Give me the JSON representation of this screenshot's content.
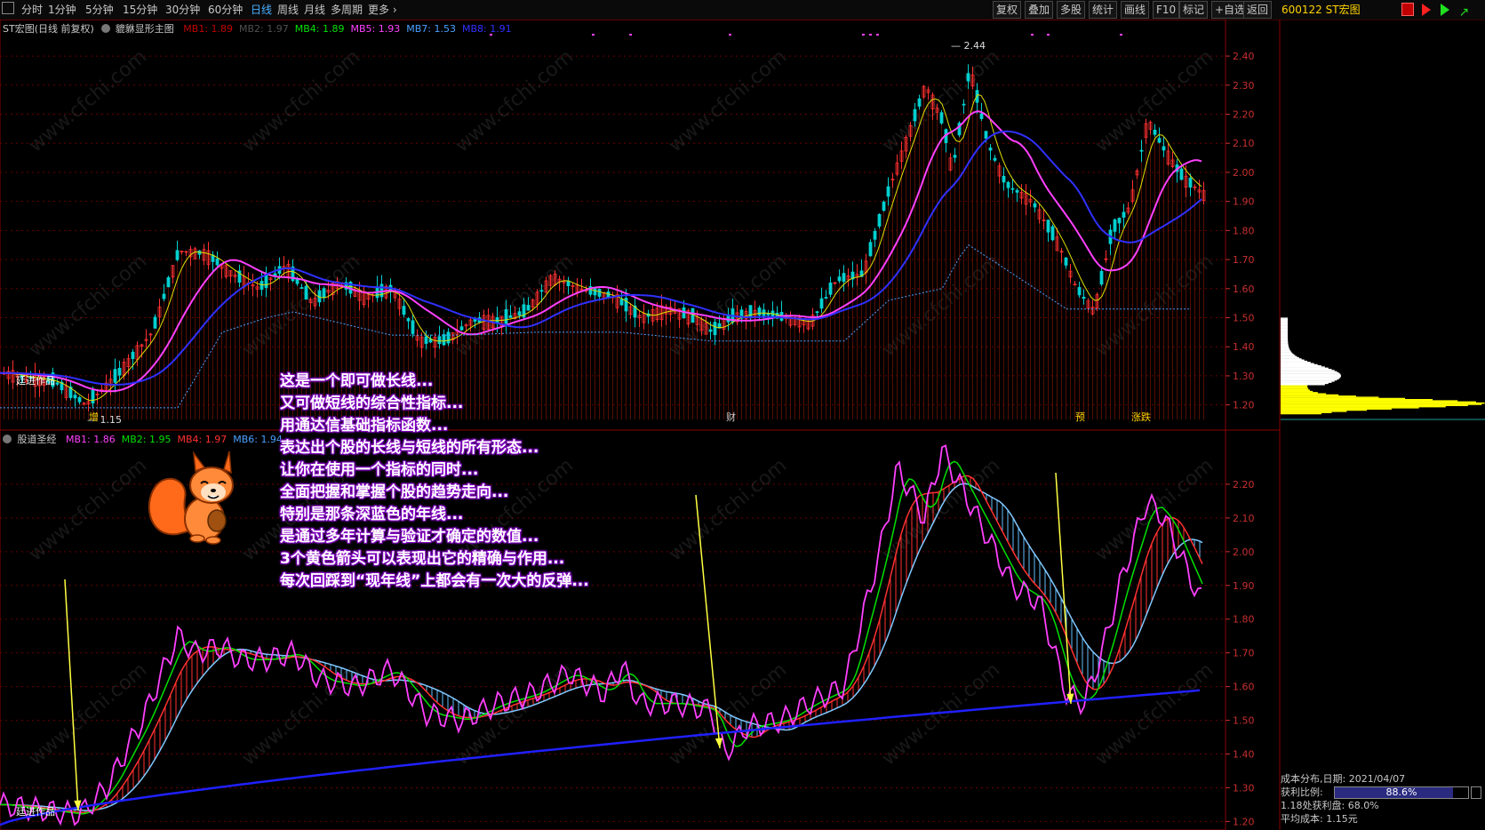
{
  "toolbar": {
    "periods": [
      "分时",
      "1分钟",
      "5分钟",
      "15分钟",
      "30分钟",
      "60分钟",
      "日线",
      "周线",
      "月线",
      "多周期",
      "更多"
    ],
    "active_period": "日线",
    "right_buttons": [
      "复权",
      "叠加",
      "多股",
      "统计",
      "画线",
      "F10",
      "标记",
      "+自选",
      "返回"
    ],
    "stock_code": "600122 ST宏图"
  },
  "main_panel": {
    "title": "ST宏图(日线 前复权)",
    "indicator_name": "貔貅显形主图",
    "legend": [
      {
        "text": "MB1: 1.89",
        "color": "#c00000"
      },
      {
        "text": "MB2: 1.97",
        "color": "#505050"
      },
      {
        "text": "MB4: 1.89",
        "color": "#00e000"
      },
      {
        "text": "MB5: 1.93",
        "color": "#ff40ff"
      },
      {
        "text": "MB7: 1.53",
        "color": "#4aa0ff"
      },
      {
        "text": "MB8: 1.91",
        "color": "#3030ff"
      }
    ],
    "y_ticks": [
      "2.40",
      "2.30",
      "2.20",
      "2.10",
      "2.00",
      "1.90",
      "1.80",
      "1.70",
      "1.60",
      "1.50",
      "1.40",
      "1.30",
      "1.20"
    ],
    "high_label": "2.44",
    "low_label": "1.15",
    "watermark_label": "廷进作品",
    "markers": [
      {
        "text": "增",
        "color": "#ffd400"
      },
      {
        "text": "财",
        "color": "#c8c8c8"
      },
      {
        "text": "预",
        "color": "#ffd400"
      },
      {
        "text": "涨跌",
        "color": "#ffd400"
      }
    ]
  },
  "sub_panel": {
    "title": "股道圣经",
    "legend": [
      {
        "text": "MB1: 1.86",
        "color": "#ff40ff"
      },
      {
        "text": "MB2: 1.95",
        "color": "#00e000"
      },
      {
        "text": "MB4: 1.97",
        "color": "#ff3030"
      },
      {
        "text": "MB6: 1.94",
        "color": "#4aa0ff"
      }
    ],
    "y_ticks": [
      "2.20",
      "2.10",
      "2.00",
      "1.90",
      "1.80",
      "1.70",
      "1.60",
      "1.50",
      "1.40",
      "1.30",
      "1.20"
    ],
    "watermark_label": "廷进作品"
  },
  "annotation_lines": [
    "这是一个即可做长线...",
    "又可做短线的综合性指标...",
    "用通达信基础指标函数...",
    "表达出个股的长线与短线的所有形态...",
    "让你在使用一个指标的同时...",
    "全面把握和掌握个股的趋势走向...",
    "特别是那条深蓝色的年线...",
    "是通过多年计算与验证才确定的数值...",
    "3个黄色箭头可以表现出它的精确与作用...",
    "每次回踩到“现年线”上都会有一次大的反弹..."
  ],
  "cost_panel": {
    "date_label": "成本分布,日期: 2021/04/07",
    "profit_ratio_label": "获利比例:",
    "profit_ratio_value": "88.6%",
    "profit_ratio_fraction": 0.886,
    "profit_line": "1.18处获利盘: 68.0%",
    "avg_cost_line": "平均成本: 1.15元"
  },
  "watermark": "www.cfchi.com",
  "colors": {
    "up_candle": "#ff3030",
    "down_candle": "#00d0d0",
    "grid": "#6a0000",
    "axis_text": "#c83030",
    "ma_magenta": "#ff40ff",
    "ma_blue": "#3030ff",
    "arrow": "#ffff40",
    "chip": "#ffff00"
  }
}
